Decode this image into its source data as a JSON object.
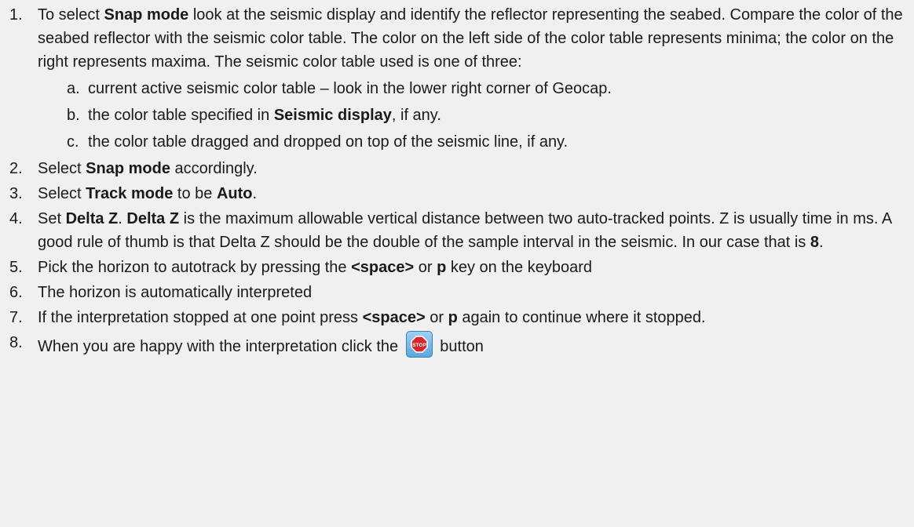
{
  "steps": [
    {
      "num": "1.",
      "parts": [
        {
          "t": "To select "
        },
        {
          "b": "Snap mode"
        },
        {
          "t": " look at the seismic display and identify the reflector representing the seabed. Compare the color of the seabed reflector with the seismic color table. The color on the left side of the color table represents minima; the color on the right represents maxima. The seismic color table used is one of three:"
        }
      ],
      "sub": [
        {
          "letter": "a.",
          "parts": [
            {
              "t": "current active seismic color table – look in the lower right corner of Geocap."
            }
          ]
        },
        {
          "letter": "b.",
          "parts": [
            {
              "t": "the color table specified in "
            },
            {
              "b": "Seismic display"
            },
            {
              "t": ", if any."
            }
          ]
        },
        {
          "letter": "c.",
          "parts": [
            {
              "t": "the color table dragged and dropped on top of the seismic line, if any."
            }
          ]
        }
      ]
    },
    {
      "num": "2.",
      "parts": [
        {
          "t": "Select "
        },
        {
          "b": "Snap mode"
        },
        {
          "t": " accordingly."
        }
      ]
    },
    {
      "num": "3.",
      "parts": [
        {
          "t": "Select "
        },
        {
          "b": "Track mode"
        },
        {
          "t": " to be "
        },
        {
          "b": "Auto"
        },
        {
          "t": "."
        }
      ]
    },
    {
      "num": "4.",
      "parts": [
        {
          "t": "Set "
        },
        {
          "b": "Delta Z"
        },
        {
          "t": ". "
        },
        {
          "b": "Delta Z"
        },
        {
          "t": " is the maximum allowable vertical distance between two auto-tracked points. Z is usually time in ms. A good rule of thumb is that Delta Z should be the double of the sample interval in the seismic. In our case that is "
        },
        {
          "b": "8"
        },
        {
          "t": "."
        }
      ]
    },
    {
      "num": "5.",
      "parts": [
        {
          "t": "Pick the horizon to autotrack by pressing the "
        },
        {
          "b": "<space>"
        },
        {
          "t": " or "
        },
        {
          "b": "p"
        },
        {
          "t": " key on the keyboard"
        }
      ]
    },
    {
      "num": "6.",
      "parts": [
        {
          "t": "The horizon is automatically interpreted"
        }
      ]
    },
    {
      "num": "7.",
      "parts": [
        {
          "t": "If the interpretation stopped at one point press "
        },
        {
          "b": "<space>"
        },
        {
          "t": " or "
        },
        {
          "b": "p"
        },
        {
          "t": " again to continue where it stopped."
        }
      ]
    }
  ],
  "step8": {
    "num": "8.",
    "before": "When you are happy with the interpretation click the ",
    "icon_label": "STOP",
    "after": " button"
  }
}
